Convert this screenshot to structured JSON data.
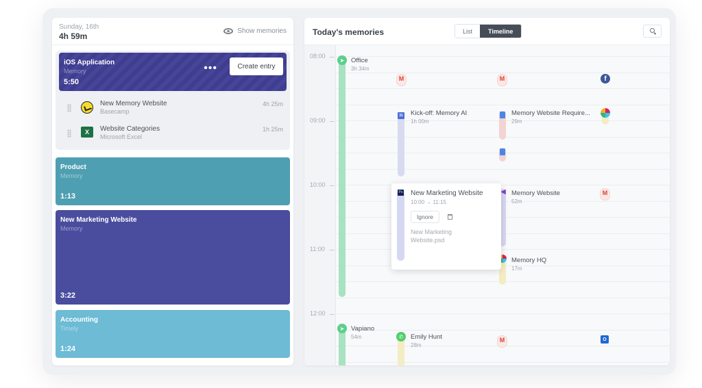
{
  "left_panel": {
    "date": "Sunday, 16th",
    "total": "4h 59m",
    "show_memories": "Show memories",
    "active_card": {
      "title": "iOS Application",
      "subtitle": "Memory",
      "time": "5:50",
      "more_label": "•••",
      "create_entry": "Create entry"
    },
    "entries": [
      {
        "title": "New Memory Website",
        "app": "Basecamp",
        "duration": "4h 25m",
        "icon": "basecamp-icon"
      },
      {
        "title": "Website Categories",
        "app": "Microsoft Excel",
        "duration": "1h 25m",
        "icon": "excel-icon",
        "icon_text": "X"
      }
    ],
    "cards": [
      {
        "title": "Product",
        "subtitle": "Memory",
        "time": "1:13",
        "color": "#4f9fb2"
      },
      {
        "title": "New Marketing Website",
        "subtitle": "Memory",
        "time": "3:22",
        "color": "#4a4c9e"
      },
      {
        "title": "Accounting",
        "subtitle": "Timely",
        "time": "1:24",
        "color": "#6dbbd5"
      }
    ]
  },
  "right_panel": {
    "title": "Today's memories",
    "view_toggle": {
      "options": [
        "List",
        "Timeline"
      ],
      "selected": "Timeline"
    },
    "search_icon": "search-icon",
    "hours": [
      "08:00",
      "09:00",
      "10:00",
      "11:00",
      "12:00"
    ],
    "events": {
      "office": {
        "title": "Office",
        "duration": "3h 34m"
      },
      "kickoff": {
        "title": "Kick-off: Memory AI",
        "duration": "1h 00m",
        "icon_text": "31"
      },
      "mem_req": {
        "title": "Memory Website Require...",
        "duration": "29m"
      },
      "mem_website": {
        "title": "Memory Website",
        "duration": "52m"
      },
      "mem_hq": {
        "title": "Memory HQ",
        "duration": "17m"
      },
      "vapiano": {
        "title": "Vapiano",
        "duration": "54m"
      },
      "emily": {
        "title": "Emily Hunt",
        "duration": "28m"
      }
    },
    "popover": {
      "title": "New Marketing Website",
      "time": "10:00 → 11:15",
      "ignore": "Ignore",
      "file": "New Marketing Website.psd",
      "icon_text": "Ps"
    },
    "icon_glyphs": {
      "gmail": "M",
      "facebook": "f",
      "outlook": "O"
    }
  }
}
